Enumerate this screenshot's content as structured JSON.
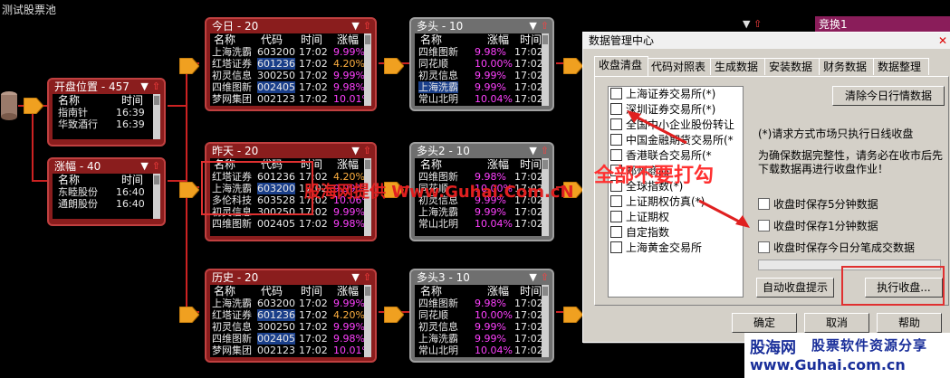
{
  "window": {
    "title": "测试股票池"
  },
  "source_node_icon": "database-icon",
  "panels": {
    "open_pos": {
      "title": "开盘位置 - 457",
      "headers": [
        "名称",
        "时间"
      ],
      "rows": [
        [
          "指南针",
          "16:39"
        ],
        [
          "华致酒行",
          "16:39"
        ]
      ]
    },
    "rise": {
      "title": "涨幅 - 40",
      "headers": [
        "名称",
        "时间"
      ],
      "rows": [
        [
          "东睦股份",
          "16:40"
        ],
        [
          "通朗股份",
          "16:40"
        ]
      ]
    },
    "today": {
      "title": "今日 - 20",
      "headers": [
        "名称",
        "代码",
        "时间",
        "涨幅"
      ],
      "rows": [
        [
          "上海洗霸",
          "603200",
          "17:02",
          "9.99%"
        ],
        [
          "红塔证券",
          "601236",
          "17:02",
          "4.20%"
        ],
        [
          "初灵信息",
          "300250",
          "17:02",
          "9.99%"
        ],
        [
          "四维图新",
          "002405",
          "17:02",
          "9.98%"
        ],
        [
          "梦网集团",
          "002123",
          "17:02",
          "10.01%"
        ]
      ]
    },
    "yesterday": {
      "title": "昨天 - 20",
      "headers": [
        "名称",
        "代码",
        "时间",
        "涨幅"
      ],
      "rows": [
        [
          "红塔证券",
          "601236",
          "17:02",
          "4.20%"
        ],
        [
          "上海洗霸",
          "603200",
          "17:02",
          "9.99%"
        ],
        [
          "多伦科技",
          "603528",
          "17:02",
          "10.06%"
        ],
        [
          "初灵信息",
          "300250",
          "17:02",
          "9.99%"
        ],
        [
          "四维图新",
          "002405",
          "17:02",
          "9.98%"
        ]
      ]
    },
    "history": {
      "title": "历史 - 20",
      "headers": [
        "名称",
        "代码",
        "时间",
        "涨幅"
      ],
      "rows": [
        [
          "上海洗霸",
          "603200",
          "17:02",
          "9.99%"
        ],
        [
          "红塔证券",
          "601236",
          "17:02",
          "4.20%"
        ],
        [
          "初灵信息",
          "300250",
          "17:02",
          "9.99%"
        ],
        [
          "四维图新",
          "002405",
          "17:02",
          "9.98%"
        ],
        [
          "梦网集团",
          "002123",
          "17:02",
          "10.01%"
        ]
      ]
    },
    "long1": {
      "title": "多头 - 10",
      "headers": [
        "名称",
        "涨幅",
        "时间"
      ],
      "rows": [
        [
          "四维图新",
          "9.98%",
          "17:02"
        ],
        [
          "同花顺",
          "10.00%",
          "17:02"
        ],
        [
          "初灵信息",
          "9.99%",
          "17:02"
        ],
        [
          "上海洗霸",
          "9.99%",
          "17:02"
        ],
        [
          "常山北明",
          "10.04%",
          "17:02"
        ]
      ]
    },
    "long2": {
      "title": "多头2 - 10",
      "headers": [
        "名称",
        "涨幅",
        "时间"
      ],
      "rows": [
        [
          "四维图新",
          "9.98%",
          "17:02"
        ],
        [
          "同花顺",
          "10.00%",
          "17:02"
        ],
        [
          "初灵信息",
          "9.99%",
          "17:02"
        ],
        [
          "上海洗霸",
          "9.99%",
          "17:02"
        ],
        [
          "常山北明",
          "10.04%",
          "17:02"
        ]
      ]
    },
    "long3": {
      "title": "多头3 - 10",
      "headers": [
        "名称",
        "涨幅",
        "时间"
      ],
      "rows": [
        [
          "四维图新",
          "9.98%",
          "17:02"
        ],
        [
          "同花顺",
          "10.00%",
          "17:02"
        ],
        [
          "初灵信息",
          "9.99%",
          "17:02"
        ],
        [
          "上海洗霸",
          "9.99%",
          "17:02"
        ],
        [
          "常山北明",
          "10.04%",
          "17:02"
        ]
      ]
    }
  },
  "right_strip": {
    "label": "竞换1"
  },
  "dialog": {
    "title": "数据管理中心",
    "close": "✕",
    "tabs": [
      "收盘清盘",
      "代码对照表",
      "生成数据",
      "安装数据",
      "财务数据",
      "数据整理"
    ],
    "markets": [
      "上海证券交易所(*)",
      "深圳证券交易所(*)",
      "全国中小企业股份转让",
      "中国金融期货交易所(*",
      "香港联合交易所(*",
      "郑州商品",
      "全球指数(*)",
      "上证期权仿真(*)",
      "上证期权",
      "自定指数",
      "上海黄金交易所"
    ],
    "clear_button": "清除今日行情数据",
    "note1": "(*)请求方式市场只执行日线收盘",
    "note2": "为确保数据完整性，请务必在收市后先下载数据再进行收盘作业！",
    "options": [
      "收盘时保存5分钟数据",
      "收盘时保存1分钟数据",
      "收盘时保存今日分笔成交数据"
    ],
    "auto_button": "自动收盘提示",
    "exec_button": "执行收盘...",
    "ok": "确定",
    "cancel": "取消",
    "help": "帮助"
  },
  "annotations": {
    "watermark": "股海网提供 Www.Guhai.Com.cN",
    "note": "全部不要打勾"
  },
  "logo": {
    "brand": "股海网",
    "slogan": "股票软件资源分享",
    "url": "www.Guhai.com.cn"
  }
}
